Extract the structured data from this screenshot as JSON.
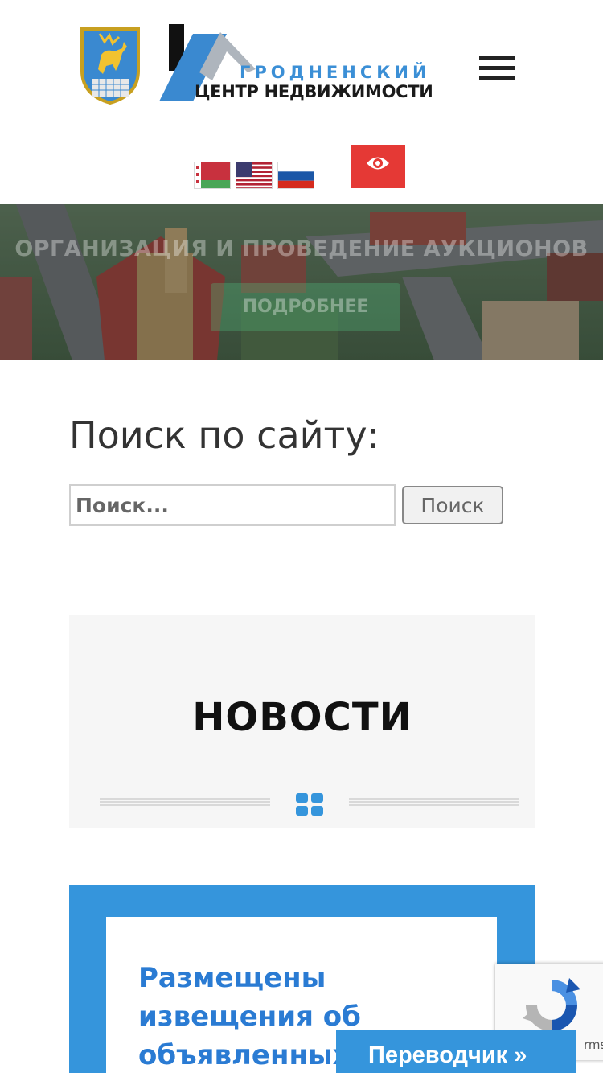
{
  "header": {
    "logo_line1": "ГРОДНЕНСКИЙ",
    "logo_line2": "ЦЕНТР НЕДВИЖИМОСТИ",
    "coat_of_arms": "grodno-coat-of-arms",
    "menu_icon": "hamburger-menu-icon",
    "languages": [
      {
        "code": "by",
        "icon": "belarus-flag-icon"
      },
      {
        "code": "en",
        "icon": "usa-flag-icon"
      },
      {
        "code": "ru",
        "icon": "russia-flag-icon"
      }
    ],
    "accessibility_icon": "eye-icon",
    "accessibility_color": "#e53935"
  },
  "hero": {
    "title": "ОРГАНИЗАЦИЯ И ПРОВЕДЕНИЕ АУКЦИОНОВ",
    "button_label": "ПОДРОБНЕЕ"
  },
  "search": {
    "title": "Поиск по сайту:",
    "placeholder": "Поиск...",
    "button_label": "Поиск"
  },
  "news": {
    "title": "НОВОСТИ",
    "divider_icon": "grid-icon"
  },
  "article": {
    "title": "Размещены извещения об объявленных"
  },
  "recaptcha": {
    "terms": "rms"
  },
  "translator": {
    "label": "Переводчик »"
  },
  "colors": {
    "accent_blue": "#3595dc",
    "link_blue": "#2a7bd3",
    "red": "#e53935"
  }
}
